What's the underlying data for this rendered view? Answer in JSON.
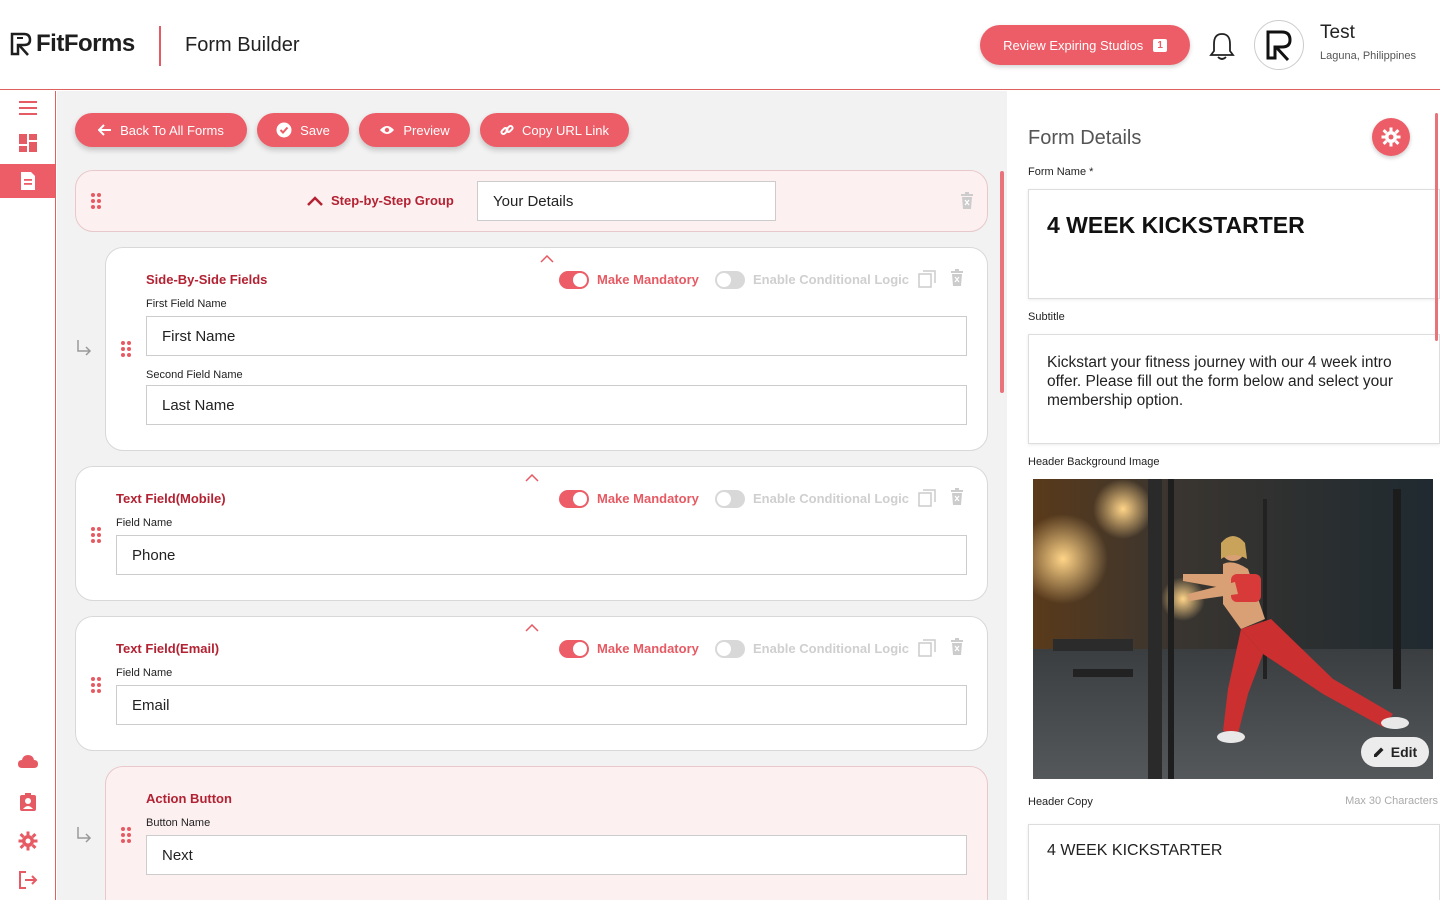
{
  "header": {
    "brand": "FitForms",
    "page_title": "Form Builder",
    "review_button": "Review Expiring Studios",
    "review_count": "1",
    "user_name": "Test",
    "user_location": "Laguna, Philippines"
  },
  "sidebar": {
    "items": [
      "menu-icon",
      "dashboard-icon",
      "forms-icon",
      "cloud-icon",
      "contact-badge-icon",
      "settings-icon",
      "logout-icon"
    ],
    "active": "forms-icon"
  },
  "toolbar": {
    "back_label": "Back To All Forms",
    "save_label": "Save",
    "preview_label": "Preview",
    "copy_label": "Copy URL Link"
  },
  "group": {
    "toggle_label": "Step-by-Step Group",
    "name_value": "Your Details"
  },
  "fields": [
    {
      "title": "Side-By-Side Fields",
      "label1": "First Field Name",
      "value1": "First Name",
      "label2": "Second Field Name",
      "value2": "Last Name",
      "mandatory_label": "Make Mandatory",
      "conditional_label": "Enable Conditional Logic"
    },
    {
      "title": "Text Field(Mobile)",
      "label1": "Field Name",
      "value1": "Phone",
      "mandatory_label": "Make Mandatory",
      "conditional_label": "Enable Conditional Logic"
    },
    {
      "title": "Text Field(Email)",
      "label1": "Field Name",
      "value1": "Email",
      "mandatory_label": "Make Mandatory",
      "conditional_label": "Enable Conditional Logic"
    },
    {
      "title": "Action Button",
      "label1": "Button Name",
      "value1": "Next"
    }
  ],
  "details": {
    "title": "Form Details",
    "form_name_label": "Form Name *",
    "form_name_value": "4 WEEK KICKSTARTER",
    "subtitle_label": "Subtitle",
    "subtitle_value": "Kickstart your fitness journey with our 4 week intro offer. Please fill out the form below and select your membership option.",
    "header_image_label": "Header Background Image",
    "edit_label": "Edit",
    "header_copy_label": "Header Copy",
    "header_copy_max": "Max 30 Characters",
    "header_copy_value": "4 WEEK KICKSTARTER"
  },
  "colors": {
    "accent": "#ec5d67",
    "accent_dark": "#b22232",
    "panel_bg": "#f2f2f2"
  }
}
